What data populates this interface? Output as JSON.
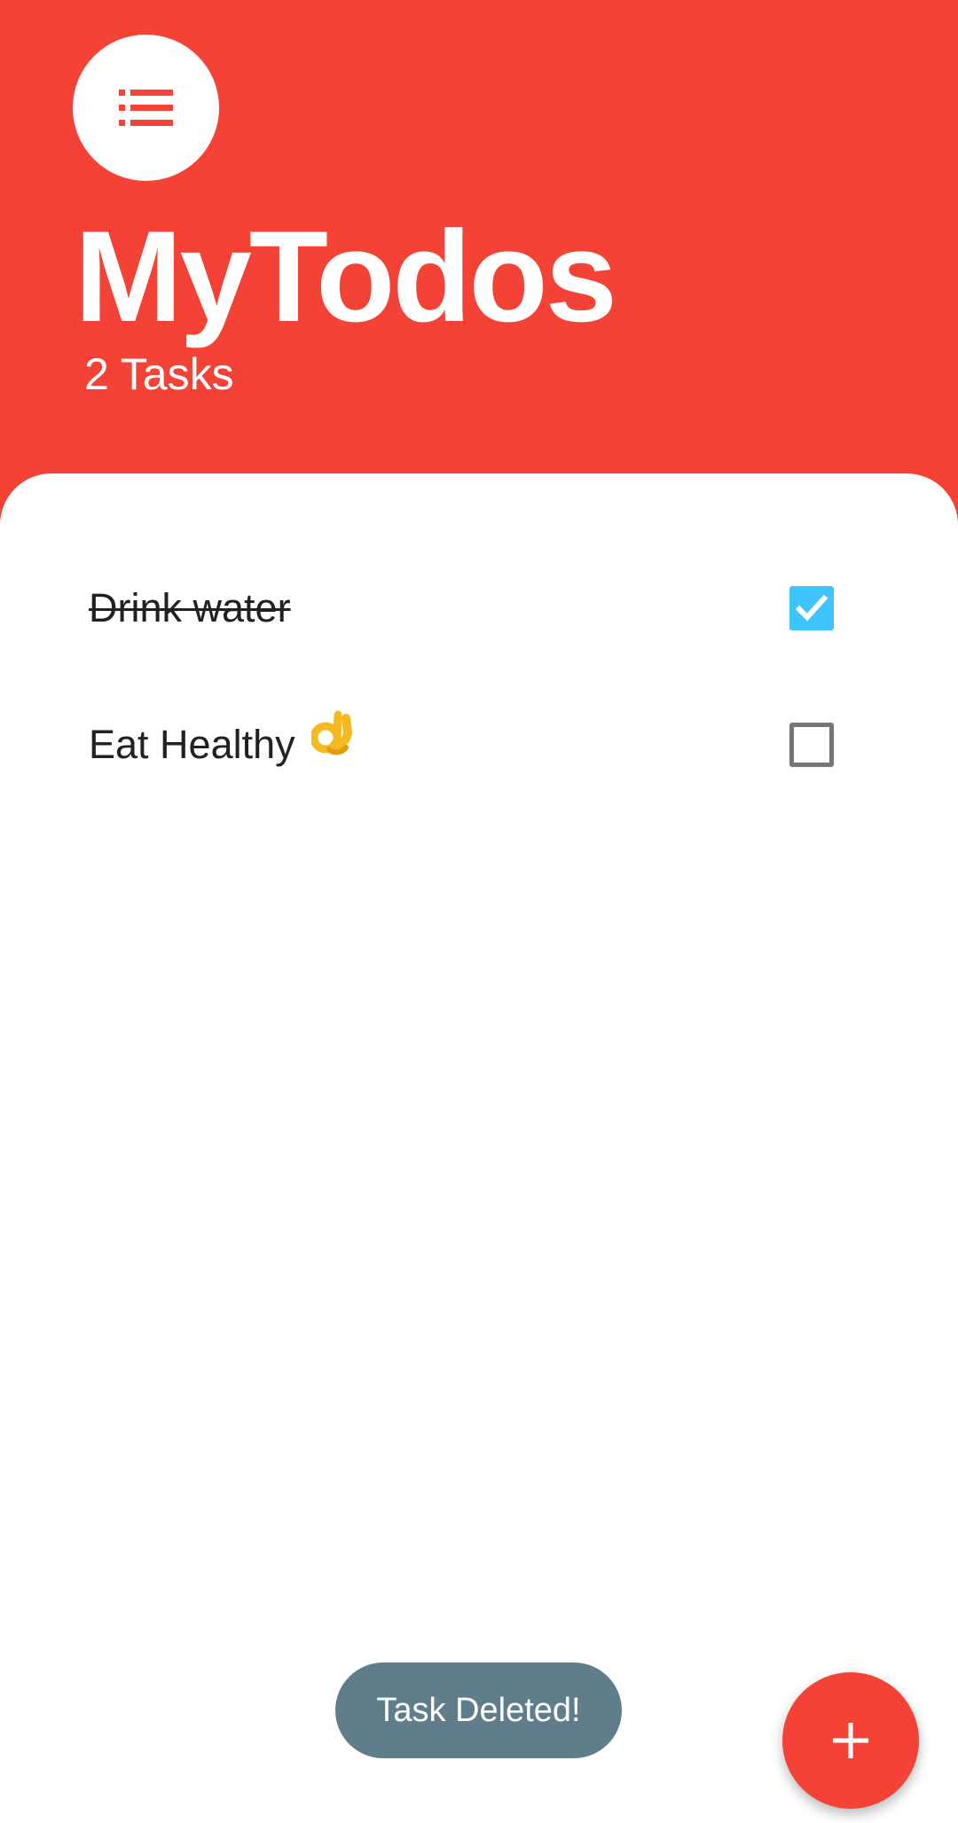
{
  "app": {
    "title": "MyTodos",
    "task_count": "2 Tasks",
    "logo_icon": "list-icon",
    "colors": {
      "primary": "#f44336",
      "checkbox_checked": "#40c4ff",
      "snackbar": "#607d8b"
    }
  },
  "todos": [
    {
      "text": "Drink water",
      "done": true
    },
    {
      "text": "Eat Healthy",
      "done": false,
      "emoji": "ok-hand-emoji"
    }
  ],
  "snackbar": {
    "message": "Task Deleted!"
  },
  "fab": {
    "icon": "plus-icon",
    "action": "add-task"
  }
}
